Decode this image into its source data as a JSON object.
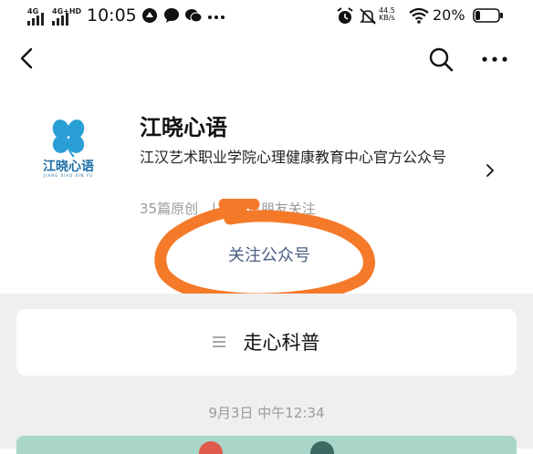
{
  "status_bar": {
    "net1": "4G",
    "net2": "4G+HD",
    "time": "10:05",
    "speed_value": "44.5",
    "speed_unit": "KB/s",
    "battery_text": "20%",
    "battery_level": 0.2,
    "icons": [
      "signal-icon",
      "signal-icon",
      "app-notification-icon",
      "chat-bubble-icon",
      "wechat-icon",
      "more-dots-icon",
      "alarm-icon",
      "mute-icon",
      "wifi-icon",
      "battery-icon"
    ]
  },
  "nav": {
    "back_icon": "back-chevron-icon",
    "search_icon": "search-icon",
    "more_icon": "more-dots-icon"
  },
  "account": {
    "logo_text": "江晓心语",
    "logo_subtext": "JIANG XIAO XIN YU",
    "name": "江晓心语",
    "description": "江汉艺术职业学院心理健康教育中心官方公众号",
    "articles": "35篇原创",
    "followers": "42位朋友关注",
    "follow_button": "关注公众号",
    "accent_color": "#4a5f82",
    "logo_color": "#1f6fa8",
    "annotation_color": "#f47a2a"
  },
  "feed": {
    "menu_label": "走心科普",
    "menu_icon": "list-lines-icon",
    "timestamp": "9月3日 中午12:34"
  }
}
